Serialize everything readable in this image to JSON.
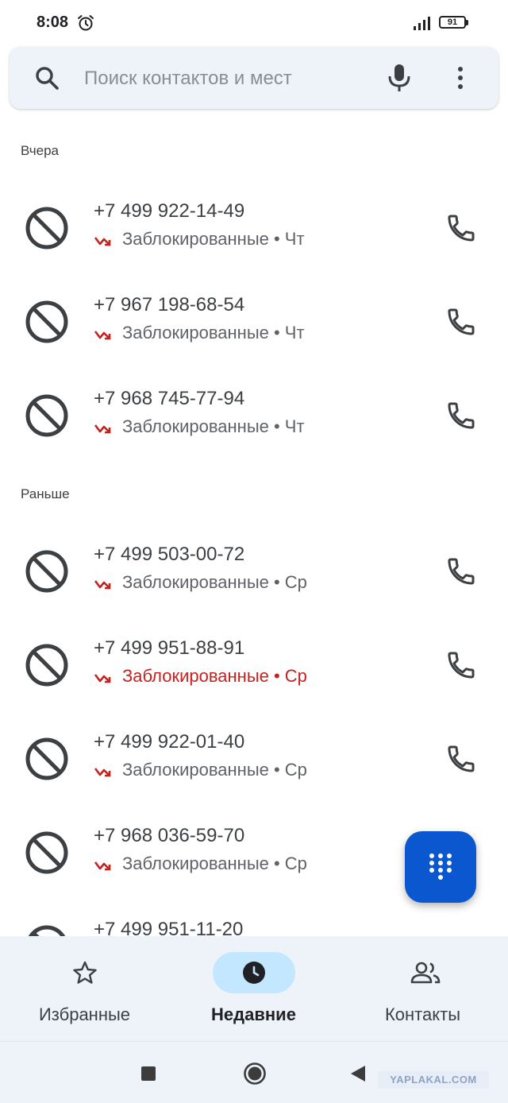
{
  "status_bar": {
    "time": "8:08",
    "battery": "91"
  },
  "search": {
    "placeholder": "Поиск контактов и мест"
  },
  "sections": [
    {
      "header": "Вчера"
    },
    {
      "header": "Раньше"
    }
  ],
  "calls": [
    {
      "number": "+7 499 922-14-49",
      "label": "Заблокированные • Чт"
    },
    {
      "number": "+7 967 198-68-54",
      "label": "Заблокированные • Чт"
    },
    {
      "number": "+7 968 745-77-94",
      "label": "Заблокированные • Чт"
    },
    {
      "number": "+7 499 503-00-72",
      "label": "Заблокированные • Ср"
    },
    {
      "number": "+7 499 951-88-91",
      "label": "Заблокированные • Ср",
      "unseen": true
    },
    {
      "number": "+7 499 922-01-40",
      "label": "Заблокированные • Ср"
    },
    {
      "number": "+7 968 036-59-70",
      "label": "Заблокированные • Ср"
    },
    {
      "number": "+7 499 951-11-20",
      "label": ""
    }
  ],
  "bottom_nav": {
    "favorites": "Избранные",
    "recents": "Недавние",
    "contacts": "Контакты",
    "active": "recents"
  },
  "watermark": "YAPLAKAL.COM",
  "colors": {
    "accent": "#0b57d0",
    "missed": "#c5221f",
    "nav_active_pill": "#c2e7ff",
    "surface": "#eef3fa"
  },
  "icons": {
    "search": "search-icon",
    "mic": "mic-icon",
    "more": "more-vert-icon",
    "blocked": "blocked-icon",
    "missed": "missed-call-icon",
    "call": "phone-icon",
    "dialpad": "dialpad-icon",
    "favorites": "star-icon",
    "recents": "clock-icon",
    "contacts": "people-icon"
  }
}
